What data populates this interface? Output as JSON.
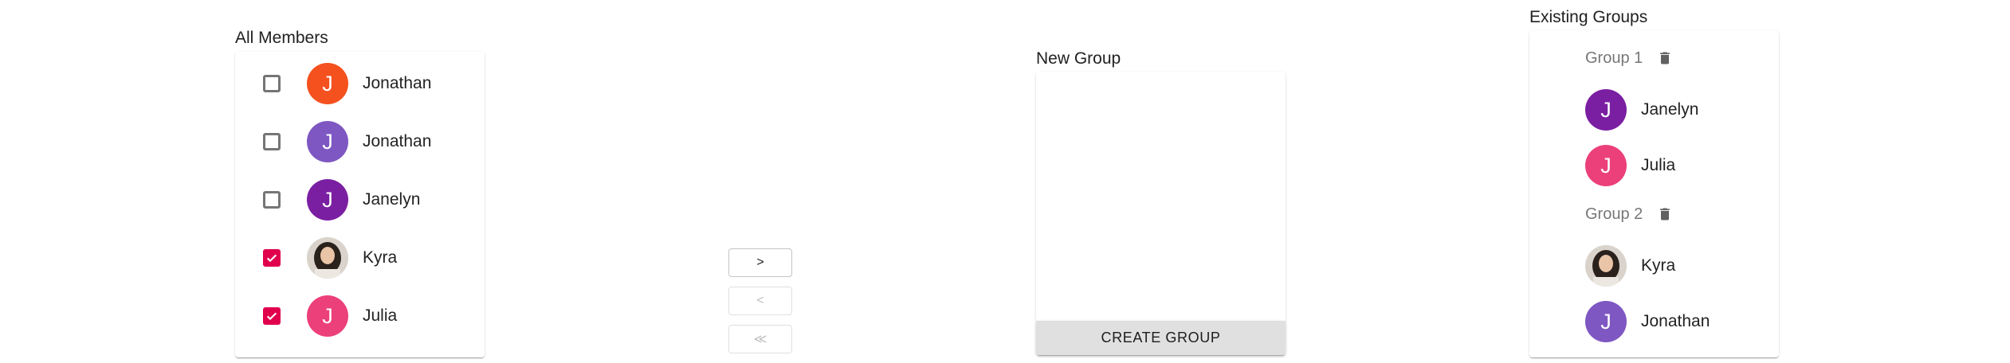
{
  "all_members": {
    "title": "All Members",
    "items": [
      {
        "name": "Jonathan",
        "initial": "J",
        "color": "#f4511e",
        "checked": false
      },
      {
        "name": "Jonathan",
        "initial": "J",
        "color": "#7e57c2",
        "checked": false
      },
      {
        "name": "Janelyn",
        "initial": "J",
        "color": "#7b1fa2",
        "checked": false
      },
      {
        "name": "Kyra",
        "initial": "",
        "color": "photo",
        "checked": true
      },
      {
        "name": "Julia",
        "initial": "J",
        "color": "#ec407a",
        "checked": true
      }
    ]
  },
  "transfer": {
    "add_label": ">",
    "remove_label": "<",
    "remove_all_label": "≪"
  },
  "new_group": {
    "title": "New Group",
    "create_label": "CREATE GROUP"
  },
  "existing_groups": {
    "title": "Existing Groups",
    "groups": [
      {
        "title": "Group 1",
        "members": [
          {
            "name": "Janelyn",
            "initial": "J",
            "color": "#7b1fa2"
          },
          {
            "name": "Julia",
            "initial": "J",
            "color": "#ec407a"
          }
        ]
      },
      {
        "title": "Group 2",
        "members": [
          {
            "name": "Kyra",
            "initial": "",
            "color": "photo"
          },
          {
            "name": "Jonathan",
            "initial": "J",
            "color": "#7e57c2"
          }
        ]
      }
    ]
  },
  "colors": {
    "checkbox_checked": "#e0004d",
    "create_button_bg": "#e0e0e0"
  }
}
